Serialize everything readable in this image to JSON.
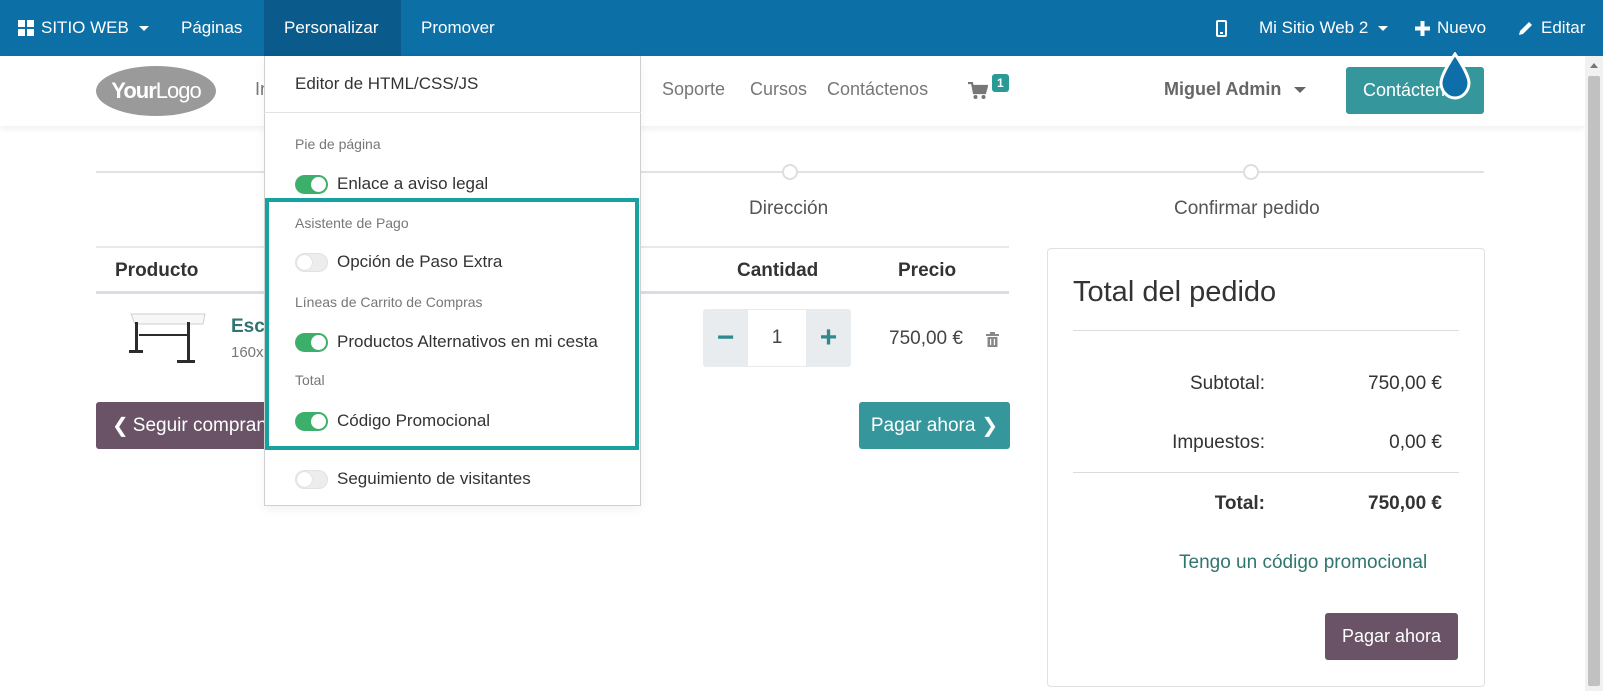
{
  "topbar": {
    "app_menu": "SITIO WEB",
    "pages": "Páginas",
    "customize": "Personalizar",
    "promote": "Promover",
    "website_selector": "Mi Sitio Web 2",
    "new": "Nuevo",
    "edit": "Editar",
    "colors": {
      "bar": "#0c6fa6",
      "active": "#0a5b8b"
    }
  },
  "header": {
    "logo": {
      "bold": "Your",
      "light": "Logo"
    },
    "nav": [
      {
        "label": "In"
      },
      {
        "label": "Soporte"
      },
      {
        "label": "Cursos"
      },
      {
        "label": "Contáctenos"
      }
    ],
    "cart_count": "1",
    "user": "Miguel Admin",
    "contact_button": "Contáctenos"
  },
  "progress": {
    "steps": [
      "Dirección",
      "Confirmar pedido"
    ]
  },
  "cart": {
    "headers": {
      "product": "Producto",
      "quantity": "Cantidad",
      "price": "Precio"
    },
    "item": {
      "name": "Esc",
      "desc": "160x",
      "quantity": "1",
      "price": "750,00 €",
      "minus": "−",
      "plus": "+"
    },
    "continue_button": "Seguir comprando",
    "pay_button": "Pagar ahora"
  },
  "summary": {
    "title": "Total del pedido",
    "subtotal_label": "Subtotal:",
    "subtotal_value": "750,00 €",
    "taxes_label": "Impuestos:",
    "taxes_value": "0,00 €",
    "total_label": "Total:",
    "total_value": "750,00 €",
    "promo_link": "Tengo un código promocional",
    "pay_button": "Pagar ahora"
  },
  "customize_menu": {
    "editor": "Editor de HTML/CSS/JS",
    "footer_header": "Pie de página",
    "legal_link": {
      "label": "Enlace a aviso legal",
      "enabled": true
    },
    "checkout_header": "Asistente de Pago",
    "extra_step": {
      "label": "Opción de Paso Extra",
      "enabled": false
    },
    "cart_lines_header": "Líneas de Carrito de Compras",
    "alternative_products": {
      "label": "Productos Alternativos en mi cesta",
      "enabled": true
    },
    "total_header": "Total",
    "promo_code": {
      "label": "Código Promocional",
      "enabled": true
    },
    "visitor_tracking": {
      "label": "Seguimiento de visitantes",
      "enabled": false
    },
    "highlight_color": "#17a2a0"
  }
}
